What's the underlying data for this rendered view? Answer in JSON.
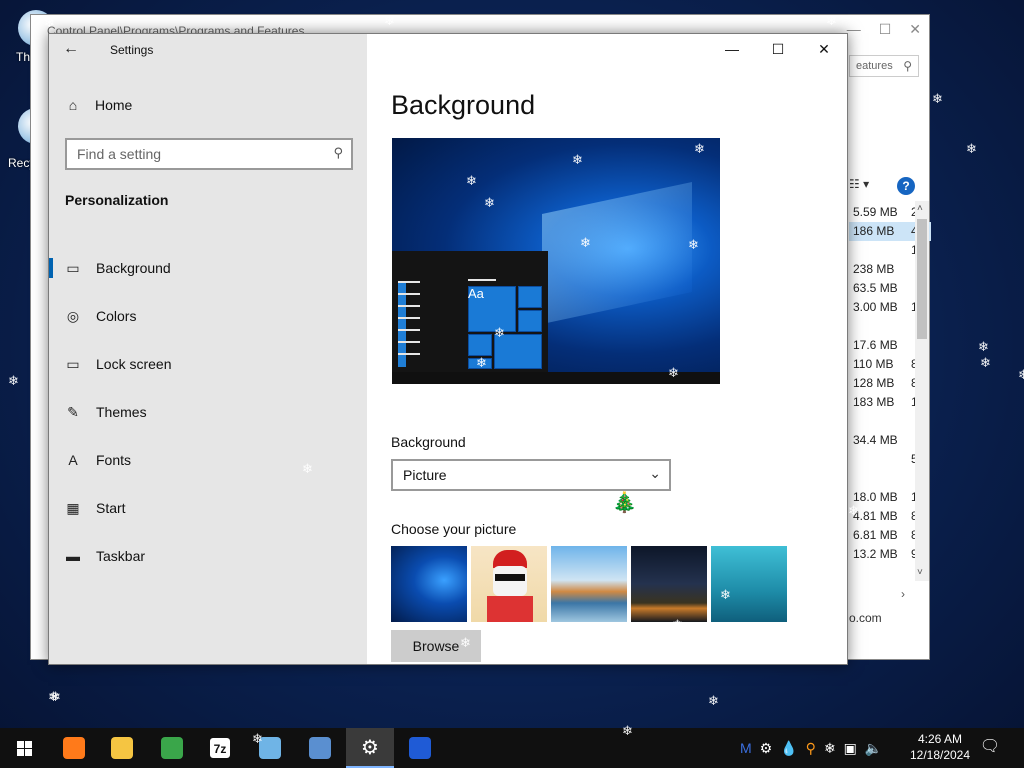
{
  "desktop": {
    "icons": [
      {
        "label": "Th",
        "name": "this-pc"
      },
      {
        "label": "Recy",
        "name": "recycle-bin"
      }
    ]
  },
  "background_window": {
    "title": "Control Panel\\Programs\\Programs and Features",
    "search_text": "eatures",
    "sizes": [
      {
        "size": "5.59 MB",
        "extra": "2"
      },
      {
        "size": "186 MB",
        "extra": "4",
        "selected": true
      },
      {
        "size": "",
        "extra": "1"
      },
      {
        "size": "238 MB",
        "extra": ""
      },
      {
        "size": "63.5 MB",
        "extra": ""
      },
      {
        "size": "3.00 MB",
        "extra": "1"
      },
      {
        "size": "",
        "extra": ""
      },
      {
        "size": "17.6 MB",
        "extra": ""
      },
      {
        "size": "110 MB",
        "extra": "8"
      },
      {
        "size": "128 MB",
        "extra": "8"
      },
      {
        "size": "183 MB",
        "extra": "1"
      },
      {
        "size": "",
        "extra": ""
      },
      {
        "size": "34.4 MB",
        "extra": ""
      },
      {
        "size": "",
        "extra": "5"
      },
      {
        "size": "",
        "extra": ""
      },
      {
        "size": "18.0 MB",
        "extra": "1"
      },
      {
        "size": "4.81 MB",
        "extra": "8"
      },
      {
        "size": "6.81 MB",
        "extra": "8"
      },
      {
        "size": "13.2 MB",
        "extra": "9"
      }
    ],
    "footer_text": "o.com",
    "column_header": "V"
  },
  "settings": {
    "window_title": "Settings",
    "home_label": "Home",
    "search_placeholder": "Find a setting",
    "section_title": "Personalization",
    "nav": [
      {
        "label": "Background",
        "icon": "picture-icon",
        "glyph": "▭",
        "active": true
      },
      {
        "label": "Colors",
        "icon": "palette-icon",
        "glyph": "◎"
      },
      {
        "label": "Lock screen",
        "icon": "lock-screen-icon",
        "glyph": "▭"
      },
      {
        "label": "Themes",
        "icon": "brush-icon",
        "glyph": "✎"
      },
      {
        "label": "Fonts",
        "icon": "fonts-icon",
        "glyph": "A"
      },
      {
        "label": "Start",
        "icon": "start-icon",
        "glyph": "▦"
      },
      {
        "label": "Taskbar",
        "icon": "taskbar-icon",
        "glyph": "▬"
      }
    ],
    "page_title": "Background",
    "preview_sample_text": "Aa",
    "background_label": "Background",
    "background_value": "Picture",
    "choose_label": "Choose your picture",
    "browse_label": "Browse"
  },
  "taskbar": {
    "apps": [
      {
        "name": "firefox",
        "color": "#ff7a1a"
      },
      {
        "name": "file-explorer",
        "color": "#f5c542"
      },
      {
        "name": "app-green",
        "color": "#3aa64a"
      },
      {
        "name": "7zip",
        "label": "7z",
        "color": "#222222"
      },
      {
        "name": "app-blue",
        "color": "#6fb4e6"
      },
      {
        "name": "control-panel",
        "color": "#5a8fd0"
      },
      {
        "name": "settings",
        "glyph": "⚙",
        "active": true
      },
      {
        "name": "malwarebytes",
        "color": "#1f5bd6"
      }
    ],
    "time": "4:26 AM",
    "date": "12/18/2024"
  },
  "colors": {
    "accent": "#0063b1",
    "desktop": "#0b2456"
  }
}
